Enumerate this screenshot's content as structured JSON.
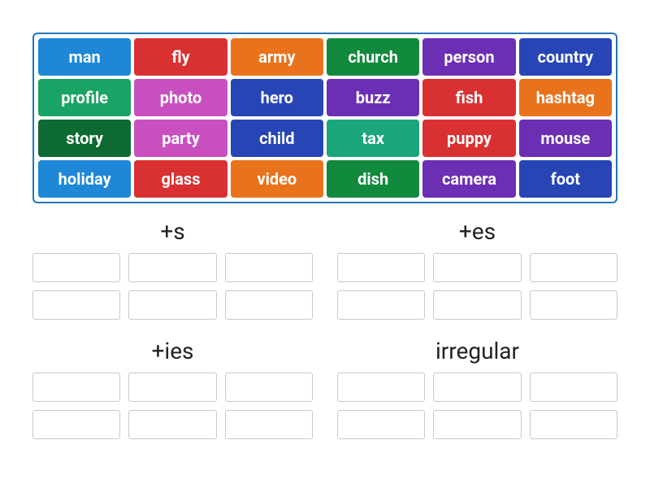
{
  "word_bank": [
    {
      "label": "man",
      "color": "c-blue"
    },
    {
      "label": "fly",
      "color": "c-red"
    },
    {
      "label": "army",
      "color": "c-orange"
    },
    {
      "label": "church",
      "color": "c-green"
    },
    {
      "label": "person",
      "color": "c-purple"
    },
    {
      "label": "country",
      "color": "c-navy"
    },
    {
      "label": "profile",
      "color": "c-ltgreen"
    },
    {
      "label": "photo",
      "color": "c-fuchsia"
    },
    {
      "label": "hero",
      "color": "c-navy"
    },
    {
      "label": "buzz",
      "color": "c-purple"
    },
    {
      "label": "fish",
      "color": "c-red"
    },
    {
      "label": "hashtag",
      "color": "c-orange"
    },
    {
      "label": "story",
      "color": "c-dkgreen"
    },
    {
      "label": "party",
      "color": "c-fuchsia"
    },
    {
      "label": "child",
      "color": "c-navy"
    },
    {
      "label": "tax",
      "color": "c-teal"
    },
    {
      "label": "puppy",
      "color": "c-red"
    },
    {
      "label": "mouse",
      "color": "c-purple"
    },
    {
      "label": "holiday",
      "color": "c-blue"
    },
    {
      "label": "glass",
      "color": "c-red"
    },
    {
      "label": "video",
      "color": "c-orange"
    },
    {
      "label": "dish",
      "color": "c-green"
    },
    {
      "label": "camera",
      "color": "c-purple"
    },
    {
      "label": "foot",
      "color": "c-navy"
    }
  ],
  "categories": [
    {
      "title": "+s",
      "slots": 6
    },
    {
      "title": "+es",
      "slots": 6
    },
    {
      "title": "+ies",
      "slots": 6
    },
    {
      "title": "irregular",
      "slots": 6
    }
  ]
}
